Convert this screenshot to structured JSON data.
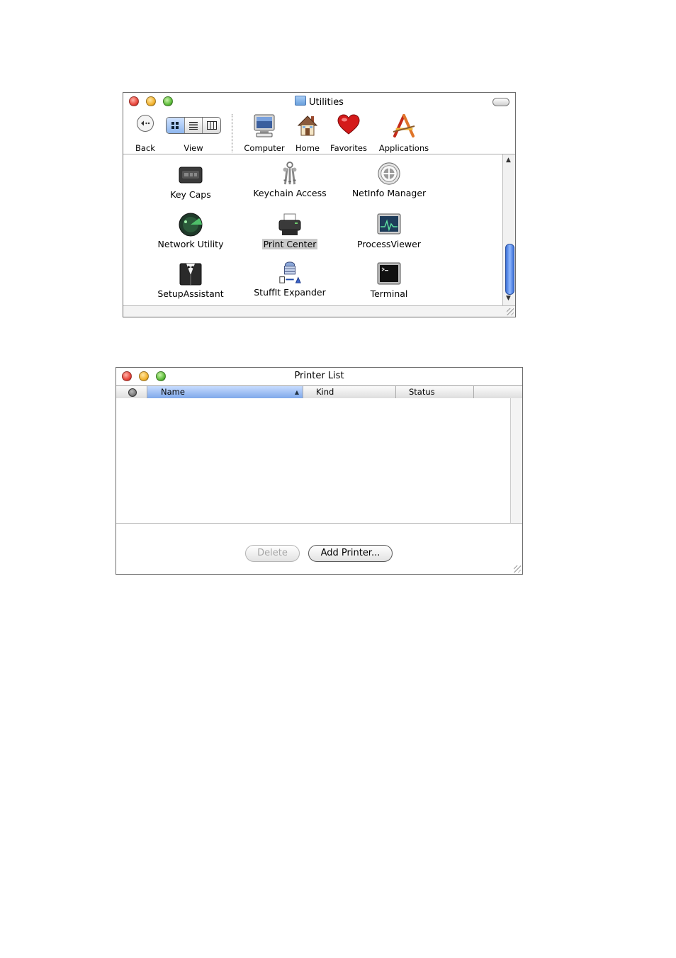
{
  "utilities_window": {
    "title": "Utilities",
    "toolbar": {
      "back": "Back",
      "view": "View",
      "computer": "Computer",
      "home": "Home",
      "favorites": "Favorites",
      "applications": "Applications"
    },
    "items": [
      {
        "label": "Key Caps",
        "icon": "keyboard-icon"
      },
      {
        "label": "Keychain Access",
        "icon": "keys-icon"
      },
      {
        "label": "NetInfo Manager",
        "icon": "netinfo-icon"
      },
      {
        "label": "Network Utility",
        "icon": "radar-icon"
      },
      {
        "label": "Print Center",
        "icon": "printer-icon",
        "selected": true
      },
      {
        "label": "ProcessViewer",
        "icon": "monitor-graph-icon"
      },
      {
        "label": "SetupAssistant",
        "icon": "tuxedo-icon"
      },
      {
        "label": "StuffIt Expander",
        "icon": "stuffit-icon"
      },
      {
        "label": "Terminal",
        "icon": "terminal-icon"
      }
    ]
  },
  "printer_window": {
    "title": "Printer List",
    "columns": {
      "name": "Name",
      "sort_indicator": "▲",
      "kind": "Kind",
      "status": "Status"
    },
    "rows": [],
    "buttons": {
      "delete": "Delete",
      "add_printer": "Add Printer..."
    }
  },
  "colors": {
    "close": "#e9463c",
    "minimize": "#f2b330",
    "zoom": "#5fbd3c",
    "selection": "#7fa8ea"
  }
}
